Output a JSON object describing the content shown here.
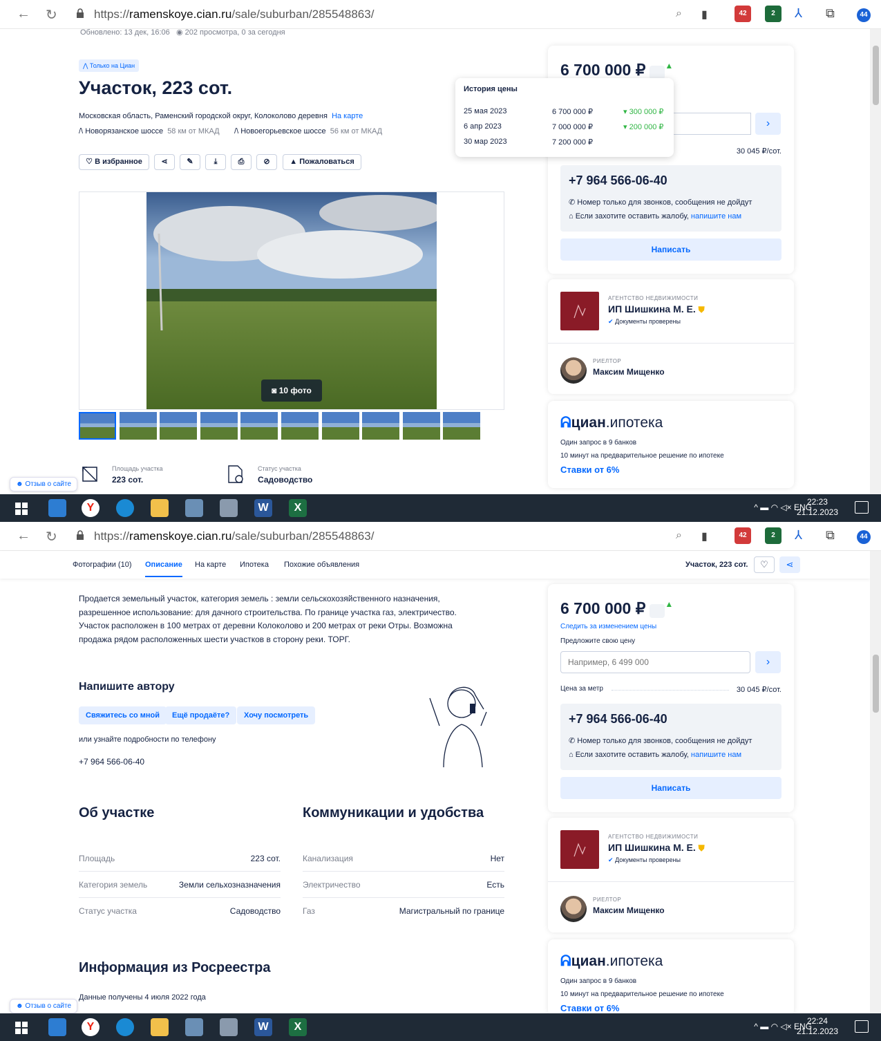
{
  "browser": {
    "url_prefix": "https://",
    "url_domain": "ramenskoye.cian.ru",
    "url_path": "/sale/suburban/285548863/",
    "ext_badge_1": "42",
    "ext_badge_2": "2",
    "ext_badge_3": "44"
  },
  "s1": {
    "updated": "Обновлено: 13 дек, 16:06",
    "views": "202 просмотра, 0 за сегодня",
    "only_badge": "Только на Циан",
    "title": "Участок, 223 сот.",
    "address": "Московская область, Раменский городской округ, Колоколово деревня",
    "on_map": "На карте",
    "highway1": "Новорязанское шоссе",
    "highway1_dist": "58 км от МКАД",
    "highway2": "Новоегорьевское шоссе",
    "highway2_dist": "56 км от МКАД",
    "fav": "В избранное",
    "complain": "Пожаловаться",
    "photo_count": "10 фото",
    "area_label": "Площадь участка",
    "area_value": "223 сот.",
    "status_label": "Статус участка",
    "status_value": "Садоводство",
    "price_history_title": "История цены",
    "price_history": [
      {
        "date": "25 мая 2023",
        "price": "6 700 000 ₽",
        "change": "300 000 ₽"
      },
      {
        "date": "6 апр 2023",
        "price": "7 000 000 ₽",
        "change": "200 000 ₽"
      },
      {
        "date": "30 мар 2023",
        "price": "7 200 000 ₽",
        "change": ""
      }
    ],
    "time": "22:23",
    "date": "21.12.2023"
  },
  "sidebar": {
    "price": "6 700 000 ₽",
    "follow": "Следить за изменением цены",
    "offer_label": "Предложите свою цену",
    "offer_placeholder": "Например, 6 499 000",
    "per_meter_label": "Цена за метр",
    "per_meter_value": "30 045 ₽/сот.",
    "phone": "+7 964 566-06-40",
    "calls_only": "Номер только для звонков, сообщения не дойдут",
    "complaint_text": "Если захотите оставить жалобу,",
    "complaint_link": "напишите нам",
    "write": "Написать",
    "agency_kind": "АГЕНТСТВО НЕДВИЖИМОСТИ",
    "agency_name": "ИП Шишкина М. Е.",
    "docs_checked": "Документы проверены",
    "realtor_kind": "РИЕЛТОР",
    "realtor_name": "Максим Мищенко",
    "ipoteka_brand": "циан",
    "ipoteka_suffix": ".ипотека",
    "ipoteka_line1": "Один запрос в 9 банков",
    "ipoteka_line2": "10 минут на предварительное решение по ипотеке",
    "ipoteka_rates": "Ставки от 6%"
  },
  "s2": {
    "tabs": [
      "Фотографии (10)",
      "Описание",
      "На карте",
      "Ипотека",
      "Похожие объявления"
    ],
    "sticky_title": "Участок, 223 сот.",
    "description": "Продается земельный участок, категория земель : земли сельскохозяйственного назначения, разрешенное использование: для дачного строительства. По границе участка газ, электричество. Участок расположен в 100 метрах от деревни Колоколово и 200 метрах от реки Отры. Возможна продажа рядом расположенных шести участков в сторону реки. ТОРГ.",
    "write_author": "Напишите автору",
    "chips": [
      "Свяжитесь со мной",
      "Ещё продаёте?",
      "Хочу посмотреть"
    ],
    "or_phone": "или узнайте подробности по телефону",
    "phone": "+7 964 566-06-40",
    "about_title": "Об участке",
    "about": [
      {
        "k": "Площадь",
        "v": "223 сот."
      },
      {
        "k": "Категория земель",
        "v": "Земли сельхозназначения"
      },
      {
        "k": "Статус участка",
        "v": "Садоводство"
      }
    ],
    "comm_title": "Коммуникации и удобства",
    "comm": [
      {
        "k": "Канализация",
        "v": "Нет"
      },
      {
        "k": "Электричество",
        "v": "Есть"
      },
      {
        "k": "Газ",
        "v": "Магистральный по границе"
      }
    ],
    "rosreestr_title": "Информация из Росреестра",
    "rosreestr_date": "Данные получены 4 июля 2022 года",
    "time": "22:24",
    "date": "21.12.2023"
  },
  "feedback": "Отзыв о сайте",
  "tray_lang": "ENG",
  "colors": {
    "accent": "#0468ff",
    "text": "#152242",
    "green": "#2fb543",
    "agency": "#8a1b27"
  }
}
